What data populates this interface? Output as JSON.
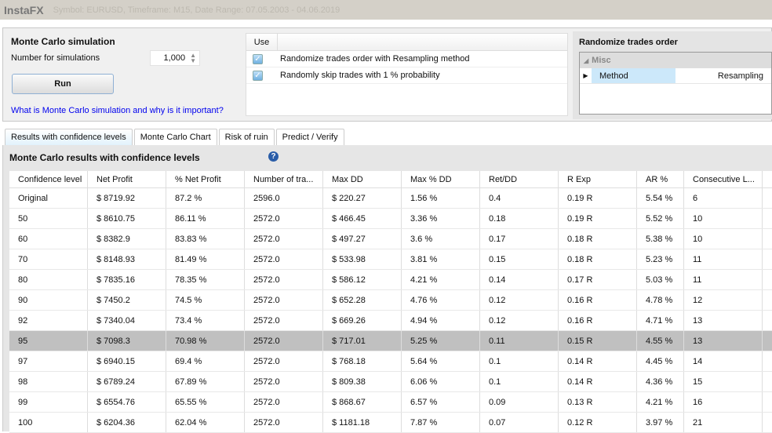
{
  "titlebar": {
    "app": "InstaFX",
    "subtitle": "Symbol: EURUSD, Timeframe: M15, Date Range: 07.05.2003 - 04.06.2019"
  },
  "sim": {
    "title": "Monte Carlo simulation",
    "number_label": "Number for simulations",
    "number_value": "1,000",
    "run_label": "Run",
    "help_link": "What is Monte Carlo simulation and why is it important?"
  },
  "use_table": {
    "header": "Use",
    "rows": [
      {
        "checked": true,
        "label": "Randomize trades order with Resampling method"
      },
      {
        "checked": true,
        "label": "Randomly skip trades with 1 % probability"
      }
    ]
  },
  "randomize": {
    "title": "Randomize trades order",
    "category": "Misc",
    "property": "Method",
    "value": "Resampling"
  },
  "tabs": [
    "Results with confidence levels",
    "Monte Carlo Chart",
    "Risk of ruin",
    "Predict / Verify"
  ],
  "results": {
    "title": "Monte Carlo results with confidence levels",
    "columns": [
      "Confidence level",
      "Net Profit",
      "% Net Profit",
      "Number of tra...",
      "Max DD",
      "Max % DD",
      "Ret/DD",
      "R Exp",
      "AR %",
      "Consecutive L..."
    ],
    "selected_row": 7,
    "rows": [
      [
        "Original",
        "$ 8719.92",
        "87.2 %",
        "2596.0",
        "$ 220.27",
        "1.56 %",
        "0.4",
        "0.19 R",
        "5.54 %",
        "6"
      ],
      [
        "50",
        "$ 8610.75",
        "86.11 %",
        "2572.0",
        "$ 466.45",
        "3.36 %",
        "0.18",
        "0.19 R",
        "5.52 %",
        "10"
      ],
      [
        "60",
        "$ 8382.9",
        "83.83 %",
        "2572.0",
        "$ 497.27",
        "3.6 %",
        "0.17",
        "0.18 R",
        "5.38 %",
        "10"
      ],
      [
        "70",
        "$ 8148.93",
        "81.49 %",
        "2572.0",
        "$ 533.98",
        "3.81 %",
        "0.15",
        "0.18 R",
        "5.23 %",
        "11"
      ],
      [
        "80",
        "$ 7835.16",
        "78.35 %",
        "2572.0",
        "$ 586.12",
        "4.21 %",
        "0.14",
        "0.17 R",
        "5.03 %",
        "11"
      ],
      [
        "90",
        "$ 7450.2",
        "74.5 %",
        "2572.0",
        "$ 652.28",
        "4.76 %",
        "0.12",
        "0.16 R",
        "4.78 %",
        "12"
      ],
      [
        "92",
        "$ 7340.04",
        "73.4 %",
        "2572.0",
        "$ 669.26",
        "4.94 %",
        "0.12",
        "0.16 R",
        "4.71 %",
        "13"
      ],
      [
        "95",
        "$ 7098.3",
        "70.98 %",
        "2572.0",
        "$ 717.01",
        "5.25 %",
        "0.11",
        "0.15 R",
        "4.55 %",
        "13"
      ],
      [
        "97",
        "$ 6940.15",
        "69.4 %",
        "2572.0",
        "$ 768.18",
        "5.64 %",
        "0.1",
        "0.14 R",
        "4.45 %",
        "14"
      ],
      [
        "98",
        "$ 6789.24",
        "67.89 %",
        "2572.0",
        "$ 809.38",
        "6.06 %",
        "0.1",
        "0.14 R",
        "4.36 %",
        "15"
      ],
      [
        "99",
        "$ 6554.76",
        "65.55 %",
        "2572.0",
        "$ 868.67",
        "6.57 %",
        "0.09",
        "0.13 R",
        "4.21 %",
        "16"
      ],
      [
        "100",
        "$ 6204.36",
        "62.04 %",
        "2572.0",
        "$ 1181.18",
        "7.87 %",
        "0.07",
        "0.12 R",
        "3.97 %",
        "21"
      ]
    ]
  }
}
